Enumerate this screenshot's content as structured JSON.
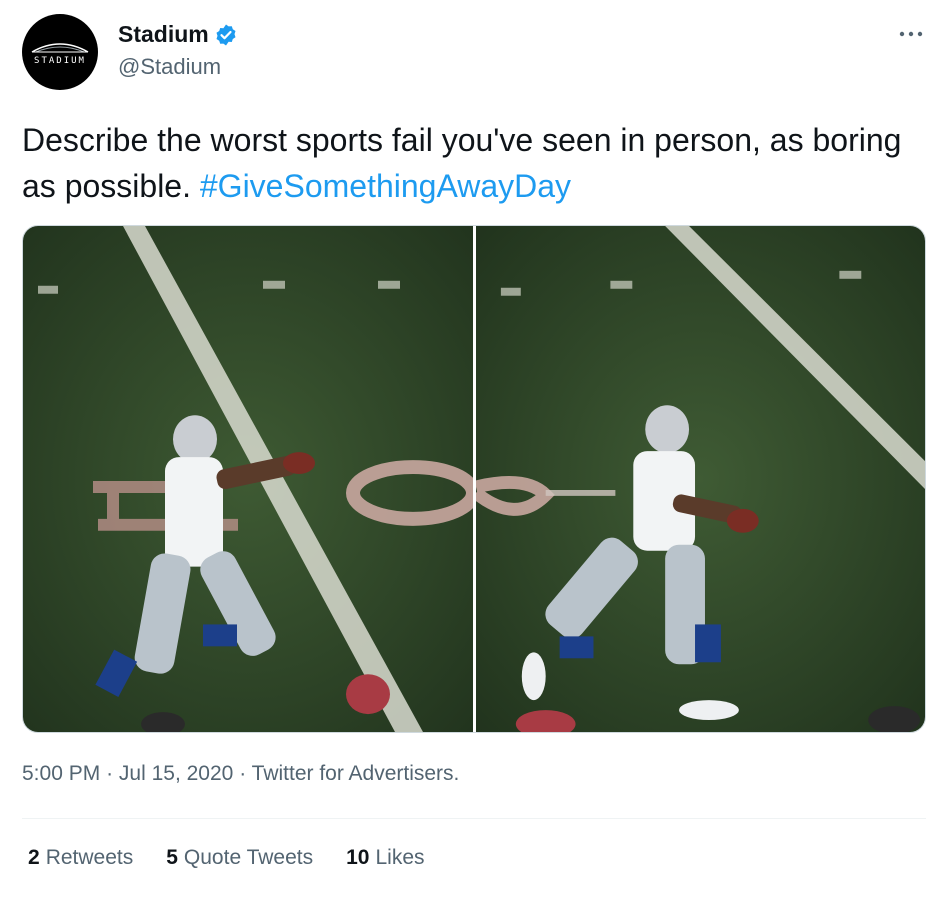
{
  "account": {
    "name": "Stadium",
    "handle": "@Stadium",
    "avatar_text": "STADIUM",
    "verified": true,
    "verified_color": "#1d9bf0"
  },
  "tweet": {
    "text": "Describe the worst sports fail you've seen in person, as boring as possible.",
    "hashtag": "#GiveSomethingAwayDay",
    "hashtag_color": "#1d9bf0"
  },
  "media": {
    "photos": [
      {
        "icon": "football-photo-left"
      },
      {
        "icon": "football-photo-right"
      }
    ]
  },
  "meta": {
    "time": "5:00 PM",
    "separator": "·",
    "date": "Jul 15, 2020",
    "source": "Twitter for Advertisers."
  },
  "stats": {
    "retweets_count": "2",
    "retweets_label": "Retweets",
    "quotes_count": "5",
    "quotes_label": "Quote Tweets",
    "likes_count": "10",
    "likes_label": "Likes"
  },
  "colors": {
    "text_primary": "#0f1419",
    "text_secondary": "#536471",
    "divider": "#eff3f4"
  }
}
